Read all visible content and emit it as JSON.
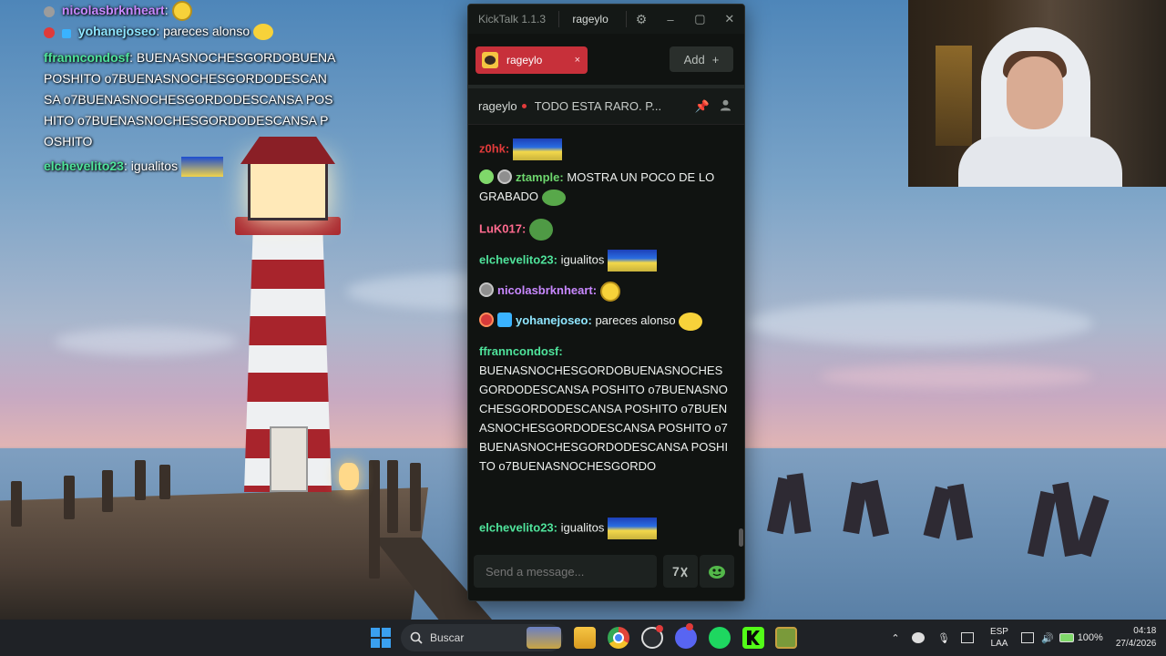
{
  "overlay_chat": [
    {
      "user": "nicolasbrknheart",
      "text": "",
      "color": "#c888ff"
    },
    {
      "user": "yohanejoseo",
      "text": "pareces alonso",
      "color": "#8fe6ff"
    },
    {
      "user": "ffranncondosf",
      "text": "BUENASNOCHESGORDOBUENA POSHITO o7BUENASNOCHESGORDODESCANSA o7BUENASNOCHESGORDODESCANSA POSHITO o7BUENASNOCHESGORDODESCANSA POSHITO",
      "color": "#4fe39b"
    },
    {
      "user": "elchevelito23",
      "text": "igualitos",
      "color": "#4fe39b"
    }
  ],
  "app": {
    "title": "KickTalk 1.1.3",
    "current_user": "rageylo",
    "icons": {
      "settings": "gear-icon",
      "minimize": "minimize-icon",
      "maximize": "maximize-icon",
      "close": "close-icon"
    }
  },
  "tabs": {
    "active_tab": {
      "label": "rageylo",
      "close_label": "×"
    },
    "add_label": "Add",
    "add_symbol": "+"
  },
  "stream_header": {
    "channel": "rageylo",
    "title": "TODO ESTA RARO. P...",
    "live": true,
    "icons": [
      "pin-icon",
      "user-icon"
    ]
  },
  "chat": {
    "messages": [
      {
        "user": "z0hk",
        "color": "#e23b3b",
        "text": "",
        "badges": []
      },
      {
        "user": "ztample",
        "color": "#6dd66d",
        "text": "MOSTRA UN POCO DE LO GRABADO",
        "badges": [
          "alien-badge",
          "silver-badge"
        ]
      },
      {
        "user": "LuK017",
        "color": "#ff6b8f",
        "text": "",
        "badges": []
      },
      {
        "user": "elchevelito23",
        "color": "#4fe39b",
        "text": "igualitos",
        "badges": []
      },
      {
        "user": "nicolasbrknheart",
        "color": "#c888ff",
        "text": "",
        "badges": [
          "silver-badge"
        ]
      },
      {
        "user": "yohanejoseo",
        "color": "#8fe6ff",
        "text": "pareces alonso",
        "badges": [
          "red-badge",
          "cube-badge"
        ]
      },
      {
        "user": "ffranncondosf",
        "color": "#4fe39b",
        "text": "BUENASNOCHESGORDOBUENASNOCHES GORDODESCANSA POSHITO o7BUENASNOCHESGORDODESCANSA POSHITO o7BUENASNOCHESGORDODESCANSA POSHITO o7BUENASNOCHESGORDODESCANSA POSHITO o7BUENASNOCHESGORDO",
        "badges": []
      },
      {
        "user": "elchevelito23",
        "color": "#4fe39b",
        "text": "igualitos",
        "badges": []
      }
    ],
    "input_placeholder": "Send a message...",
    "input_icons": [
      "translate-icon",
      "emote-icon"
    ]
  },
  "taskbar": {
    "search_label": "Buscar",
    "apps": [
      "file-explorer-icon",
      "chrome-icon",
      "obs-icon",
      "discord-icon",
      "spotify-icon",
      "kick-icon",
      "game-icon"
    ],
    "language_top": "ESP",
    "language_bottom": "LAA",
    "battery": "100%",
    "time": "04:18",
    "date": "27/4/2026"
  },
  "colors": {
    "accent_red": "#c7303a",
    "kick_green": "#53fc18",
    "window_bg": "#101311"
  }
}
